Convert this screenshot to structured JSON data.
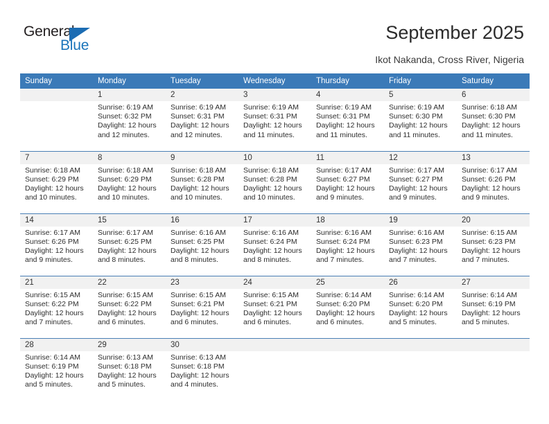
{
  "brand": {
    "name_part1": "General",
    "name_part2": "Blue",
    "accent_color": "#1b75bb",
    "triangle_color": "#1b6cb3"
  },
  "header": {
    "title": "September 2025",
    "subtitle": "Ikot Nakanda, Cross River, Nigeria",
    "header_bg": "#3b7ab8",
    "daynum_bg": "#f1f1f1"
  },
  "weekdays": [
    "Sunday",
    "Monday",
    "Tuesday",
    "Wednesday",
    "Thursday",
    "Friday",
    "Saturday"
  ],
  "weeks": [
    [
      {
        "day": "",
        "blank": true
      },
      {
        "day": "1",
        "sunrise": "Sunrise: 6:19 AM",
        "sunset": "Sunset: 6:32 PM",
        "daylight": "Daylight: 12 hours and 12 minutes."
      },
      {
        "day": "2",
        "sunrise": "Sunrise: 6:19 AM",
        "sunset": "Sunset: 6:31 PM",
        "daylight": "Daylight: 12 hours and 12 minutes."
      },
      {
        "day": "3",
        "sunrise": "Sunrise: 6:19 AM",
        "sunset": "Sunset: 6:31 PM",
        "daylight": "Daylight: 12 hours and 11 minutes."
      },
      {
        "day": "4",
        "sunrise": "Sunrise: 6:19 AM",
        "sunset": "Sunset: 6:31 PM",
        "daylight": "Daylight: 12 hours and 11 minutes."
      },
      {
        "day": "5",
        "sunrise": "Sunrise: 6:19 AM",
        "sunset": "Sunset: 6:30 PM",
        "daylight": "Daylight: 12 hours and 11 minutes."
      },
      {
        "day": "6",
        "sunrise": "Sunrise: 6:18 AM",
        "sunset": "Sunset: 6:30 PM",
        "daylight": "Daylight: 12 hours and 11 minutes."
      }
    ],
    [
      {
        "day": "7",
        "sunrise": "Sunrise: 6:18 AM",
        "sunset": "Sunset: 6:29 PM",
        "daylight": "Daylight: 12 hours and 10 minutes."
      },
      {
        "day": "8",
        "sunrise": "Sunrise: 6:18 AM",
        "sunset": "Sunset: 6:29 PM",
        "daylight": "Daylight: 12 hours and 10 minutes."
      },
      {
        "day": "9",
        "sunrise": "Sunrise: 6:18 AM",
        "sunset": "Sunset: 6:28 PM",
        "daylight": "Daylight: 12 hours and 10 minutes."
      },
      {
        "day": "10",
        "sunrise": "Sunrise: 6:18 AM",
        "sunset": "Sunset: 6:28 PM",
        "daylight": "Daylight: 12 hours and 10 minutes."
      },
      {
        "day": "11",
        "sunrise": "Sunrise: 6:17 AM",
        "sunset": "Sunset: 6:27 PM",
        "daylight": "Daylight: 12 hours and 9 minutes."
      },
      {
        "day": "12",
        "sunrise": "Sunrise: 6:17 AM",
        "sunset": "Sunset: 6:27 PM",
        "daylight": "Daylight: 12 hours and 9 minutes."
      },
      {
        "day": "13",
        "sunrise": "Sunrise: 6:17 AM",
        "sunset": "Sunset: 6:26 PM",
        "daylight": "Daylight: 12 hours and 9 minutes."
      }
    ],
    [
      {
        "day": "14",
        "sunrise": "Sunrise: 6:17 AM",
        "sunset": "Sunset: 6:26 PM",
        "daylight": "Daylight: 12 hours and 9 minutes."
      },
      {
        "day": "15",
        "sunrise": "Sunrise: 6:17 AM",
        "sunset": "Sunset: 6:25 PM",
        "daylight": "Daylight: 12 hours and 8 minutes."
      },
      {
        "day": "16",
        "sunrise": "Sunrise: 6:16 AM",
        "sunset": "Sunset: 6:25 PM",
        "daylight": "Daylight: 12 hours and 8 minutes."
      },
      {
        "day": "17",
        "sunrise": "Sunrise: 6:16 AM",
        "sunset": "Sunset: 6:24 PM",
        "daylight": "Daylight: 12 hours and 8 minutes."
      },
      {
        "day": "18",
        "sunrise": "Sunrise: 6:16 AM",
        "sunset": "Sunset: 6:24 PM",
        "daylight": "Daylight: 12 hours and 7 minutes."
      },
      {
        "day": "19",
        "sunrise": "Sunrise: 6:16 AM",
        "sunset": "Sunset: 6:23 PM",
        "daylight": "Daylight: 12 hours and 7 minutes."
      },
      {
        "day": "20",
        "sunrise": "Sunrise: 6:15 AM",
        "sunset": "Sunset: 6:23 PM",
        "daylight": "Daylight: 12 hours and 7 minutes."
      }
    ],
    [
      {
        "day": "21",
        "sunrise": "Sunrise: 6:15 AM",
        "sunset": "Sunset: 6:22 PM",
        "daylight": "Daylight: 12 hours and 7 minutes."
      },
      {
        "day": "22",
        "sunrise": "Sunrise: 6:15 AM",
        "sunset": "Sunset: 6:22 PM",
        "daylight": "Daylight: 12 hours and 6 minutes."
      },
      {
        "day": "23",
        "sunrise": "Sunrise: 6:15 AM",
        "sunset": "Sunset: 6:21 PM",
        "daylight": "Daylight: 12 hours and 6 minutes."
      },
      {
        "day": "24",
        "sunrise": "Sunrise: 6:15 AM",
        "sunset": "Sunset: 6:21 PM",
        "daylight": "Daylight: 12 hours and 6 minutes."
      },
      {
        "day": "25",
        "sunrise": "Sunrise: 6:14 AM",
        "sunset": "Sunset: 6:20 PM",
        "daylight": "Daylight: 12 hours and 6 minutes."
      },
      {
        "day": "26",
        "sunrise": "Sunrise: 6:14 AM",
        "sunset": "Sunset: 6:20 PM",
        "daylight": "Daylight: 12 hours and 5 minutes."
      },
      {
        "day": "27",
        "sunrise": "Sunrise: 6:14 AM",
        "sunset": "Sunset: 6:19 PM",
        "daylight": "Daylight: 12 hours and 5 minutes."
      }
    ],
    [
      {
        "day": "28",
        "sunrise": "Sunrise: 6:14 AM",
        "sunset": "Sunset: 6:19 PM",
        "daylight": "Daylight: 12 hours and 5 minutes."
      },
      {
        "day": "29",
        "sunrise": "Sunrise: 6:13 AM",
        "sunset": "Sunset: 6:18 PM",
        "daylight": "Daylight: 12 hours and 5 minutes."
      },
      {
        "day": "30",
        "sunrise": "Sunrise: 6:13 AM",
        "sunset": "Sunset: 6:18 PM",
        "daylight": "Daylight: 12 hours and 4 minutes."
      },
      {
        "day": "",
        "blank": true
      },
      {
        "day": "",
        "blank": true
      },
      {
        "day": "",
        "blank": true
      },
      {
        "day": "",
        "blank": true
      }
    ]
  ]
}
